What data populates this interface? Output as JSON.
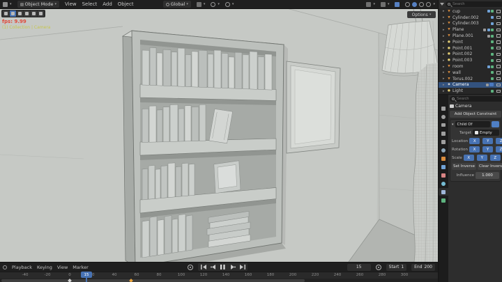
{
  "viewport": {
    "header": {
      "mode_label": "Object Mode",
      "menus": [
        "View",
        "Select",
        "Add",
        "Object"
      ],
      "orientation_label": "Global",
      "icons": [
        "editor-type-icon",
        "snap-magnet-icon",
        "pivot-point-icon",
        "proportional-editing-icon",
        "gizmo-icon",
        "overlays-icon",
        "xray-icon",
        "shading-wireframe-icon",
        "shading-solid-icon",
        "shading-material-icon",
        "shading-rendered-icon"
      ]
    },
    "options_label": "Options",
    "overlay": {
      "fps": "fps: 9.99",
      "info": "(1) Collection | Camera"
    }
  },
  "outliner": {
    "search_placeholder": "Search",
    "items": [
      {
        "name": "cup",
        "type": "mesh",
        "badges": [
          "blue",
          "green"
        ]
      },
      {
        "name": "Cylinder.002",
        "type": "mesh",
        "badges": [
          "blue"
        ]
      },
      {
        "name": "Cylinder.003",
        "type": "mesh",
        "badges": [
          "blue"
        ]
      },
      {
        "name": "Plane",
        "type": "mesh",
        "badges": [
          "gray",
          "blue",
          "green"
        ]
      },
      {
        "name": "Plane.001",
        "type": "mesh",
        "badges": [
          "gray",
          "green"
        ]
      },
      {
        "name": "Point",
        "type": "light",
        "badges": [
          "green"
        ]
      },
      {
        "name": "Point.001",
        "type": "light",
        "badges": [
          "green"
        ]
      },
      {
        "name": "Point.002",
        "type": "light",
        "badges": [
          "green"
        ]
      },
      {
        "name": "Point.003",
        "type": "light",
        "badges": [
          "green"
        ]
      },
      {
        "name": "room",
        "type": "mesh",
        "badges": [
          "blue",
          "green"
        ]
      },
      {
        "name": "wall",
        "type": "mesh",
        "badges": [
          "green"
        ]
      },
      {
        "name": "Torus.002",
        "type": "mesh",
        "badges": [
          "green"
        ]
      },
      {
        "name": "Camera",
        "type": "camera",
        "badges": [
          "gray",
          "bluebox"
        ],
        "selected": true
      },
      {
        "name": "Light",
        "type": "light",
        "badges": [
          "green"
        ]
      }
    ]
  },
  "properties": {
    "search_placeholder": "Search",
    "breadcrumb": "Camera",
    "add_button": "Add Object Constraint",
    "tabs": [
      {
        "icon": "tool"
      },
      {
        "icon": "render"
      },
      {
        "icon": "output"
      },
      {
        "icon": "viewlayer"
      },
      {
        "icon": "scene"
      },
      {
        "icon": "world"
      },
      {
        "icon": "object"
      },
      {
        "icon": "modifiers"
      },
      {
        "icon": "particles"
      },
      {
        "icon": "physics"
      },
      {
        "icon": "constraints",
        "active": true
      },
      {
        "icon": "data"
      }
    ],
    "constraint": {
      "name": "Child Of",
      "target_label": "Target",
      "target_value": "Empty",
      "rows": [
        "Location",
        "Rotation",
        "Scale"
      ],
      "axes": [
        "X",
        "Y",
        "Z"
      ],
      "set_inverse": "Set Inverse",
      "clear_inverse": "Clear Inverse",
      "influence_label": "Influence",
      "influence_value": "1.000"
    }
  },
  "timeline": {
    "menus": [
      "Playback",
      "Keying",
      "View",
      "Marker"
    ],
    "playback_icons": [
      "jump-to-start-icon",
      "prev-keyframe-icon",
      "pause-icon",
      "next-keyframe-icon",
      "jump-to-end-icon"
    ],
    "frame_current": "15",
    "start_label": "Start",
    "start_value": "1",
    "end_label": "End",
    "end_value": "200",
    "ticks": [
      "-40",
      "-20",
      "0",
      "20",
      "40",
      "60",
      "80",
      "100",
      "120",
      "140",
      "160",
      "180",
      "200",
      "220",
      "240",
      "260",
      "280",
      "300"
    ],
    "keyframes": [
      {
        "frame": 0,
        "state": "normal"
      },
      {
        "frame": 55,
        "state": "selected"
      }
    ]
  }
}
